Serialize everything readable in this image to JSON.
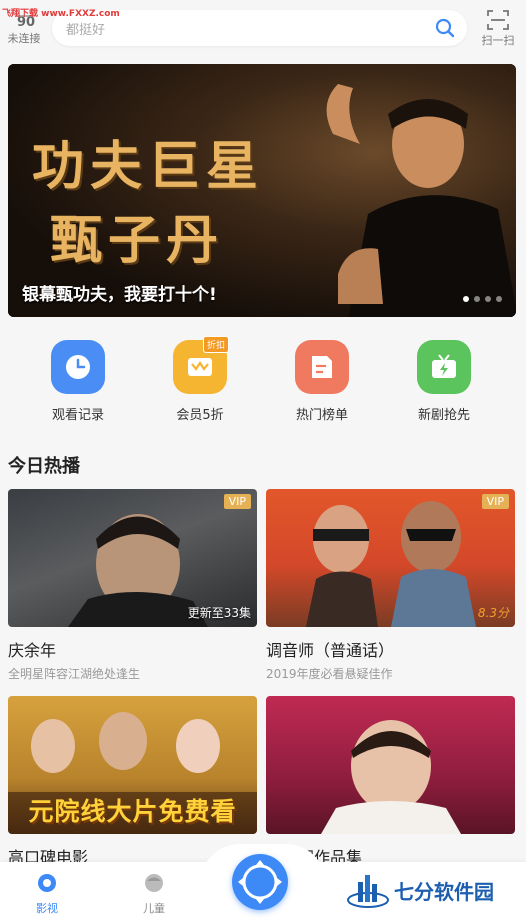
{
  "watermark": "飞翔下载 www.FXXZ.com",
  "header": {
    "connection_label": "未连接",
    "search_placeholder": "都挺好",
    "scan_label": "扫一扫"
  },
  "banner": {
    "title_line1": "功夫巨星",
    "title_line2": "甄子丹",
    "caption": "银幕甄功夫，我要打十个!",
    "pager": {
      "count": 4,
      "active": 1
    }
  },
  "quick_entries": [
    {
      "label": "观看记录",
      "icon": "clock-icon",
      "color": "#4a8ef5"
    },
    {
      "label": "会员5折",
      "icon": "crown-icon",
      "color": "#f6b531",
      "badge": "折扣"
    },
    {
      "label": "热门榜单",
      "icon": "list-icon",
      "color": "#f07a5f"
    },
    {
      "label": "新剧抢先",
      "icon": "tv-flash-icon",
      "color": "#5cc45c"
    }
  ],
  "section": {
    "title": "今日热播"
  },
  "cards": [
    {
      "title": "庆余年",
      "subtitle": "全明星阵容江湖绝处逢生",
      "vip": "VIP",
      "note": "更新至33集"
    },
    {
      "title": "调音师（普通话）",
      "subtitle": "2019年度必看悬疑佳作",
      "vip": "VIP",
      "score": "8.3分"
    },
    {
      "title": "高口碑电影",
      "poster_text": "元院线大片免费看"
    },
    {
      "title": "郭德纲作品集"
    }
  ],
  "bottom_nav": {
    "items": [
      {
        "label": "影视",
        "active": true
      },
      {
        "label": "儿童",
        "active": false
      }
    ],
    "brand": "七分软件园"
  },
  "colors": {
    "accent": "#3d8af7",
    "vip": "#e6b055"
  }
}
